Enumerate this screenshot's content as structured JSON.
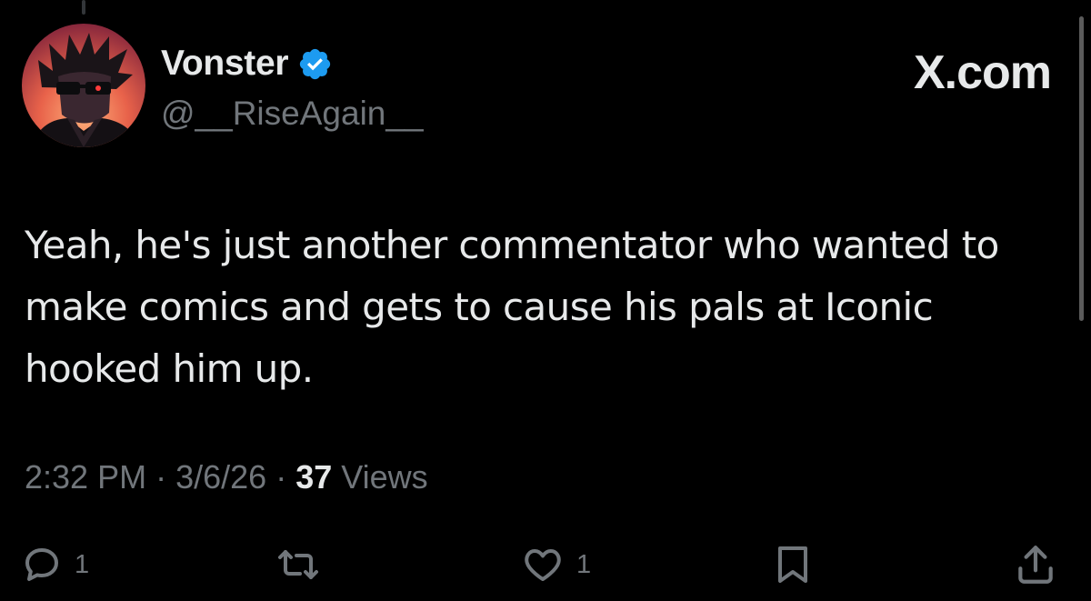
{
  "tweet": {
    "display_name": "Vonster",
    "verified": true,
    "handle": "@__RiseAgain__",
    "brand": "X.com",
    "text": "Yeah, he's just another commentator who wanted to make comics and gets to cause his pals at Iconic hooked him up.",
    "time": "2:32 PM",
    "date": "3/6/26",
    "separator": "·",
    "views_count": "37",
    "views_label": "Views"
  },
  "actions": {
    "reply_count": "1",
    "like_count": "1"
  },
  "icons": {
    "avatar": "avatar-image",
    "verified": "verified-badge-icon",
    "reply": "reply-icon",
    "retweet": "retweet-icon",
    "like": "like-icon",
    "bookmark": "bookmark-icon",
    "share": "share-icon"
  },
  "colors": {
    "background": "#000000",
    "primary_text": "#e7e9ea",
    "secondary_text": "#71767b",
    "verified_blue": "#1d9bf0"
  }
}
